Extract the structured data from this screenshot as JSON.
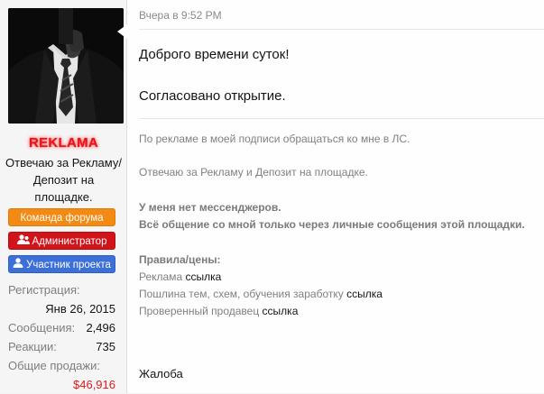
{
  "user": {
    "avatar_icon": "suit-man-avatar-icon",
    "username": "REKLAMA",
    "title": "Отвечаю за Рекламу/ Депозит на площадке.",
    "banners": {
      "forum_team": "Команда форума",
      "admin": "Администратор",
      "member": "Участник проекта"
    },
    "stats": {
      "registration_label": "Регистрация:",
      "registration_value": "Янв 26, 2015",
      "messages_label": "Сообщения:",
      "messages_value": "2,496",
      "reactions_label": "Реакции:",
      "reactions_value": "735",
      "sales_label": "Общие продажи:",
      "sales_value": "$46,916"
    }
  },
  "post": {
    "timestamp": "Вчера в 9:52 PM",
    "message_line_1": "Доброго времени суток!",
    "message_line_2": "Согласовано открытие.",
    "signature": {
      "line_1": "По рекламе в моей подписи обращаться ко мне в ЛС.",
      "line_2": "Отвечаю за Рекламу и Депозит на площадке.",
      "bold_1": "У меня нет мессенджеров.",
      "bold_2": "Всё общение со мной только через личные сообщения этой площадки.",
      "rules_title": "Правила/цены:",
      "ads_text": "Реклама",
      "ads_link": "ссылка",
      "fee_text": "Пошлина тем, схем, обучения заработку",
      "fee_link": "ссылка",
      "seller_text": "Проверенный продавец",
      "seller_link": "ссылка"
    },
    "report_label": "Жалоба"
  },
  "colors": {
    "username_red": "#e8141a",
    "banner_orange": "#f28a14",
    "banner_red": "#d0141a",
    "banner_blue": "#3d6fd8",
    "money_red": "#e21a1a"
  }
}
